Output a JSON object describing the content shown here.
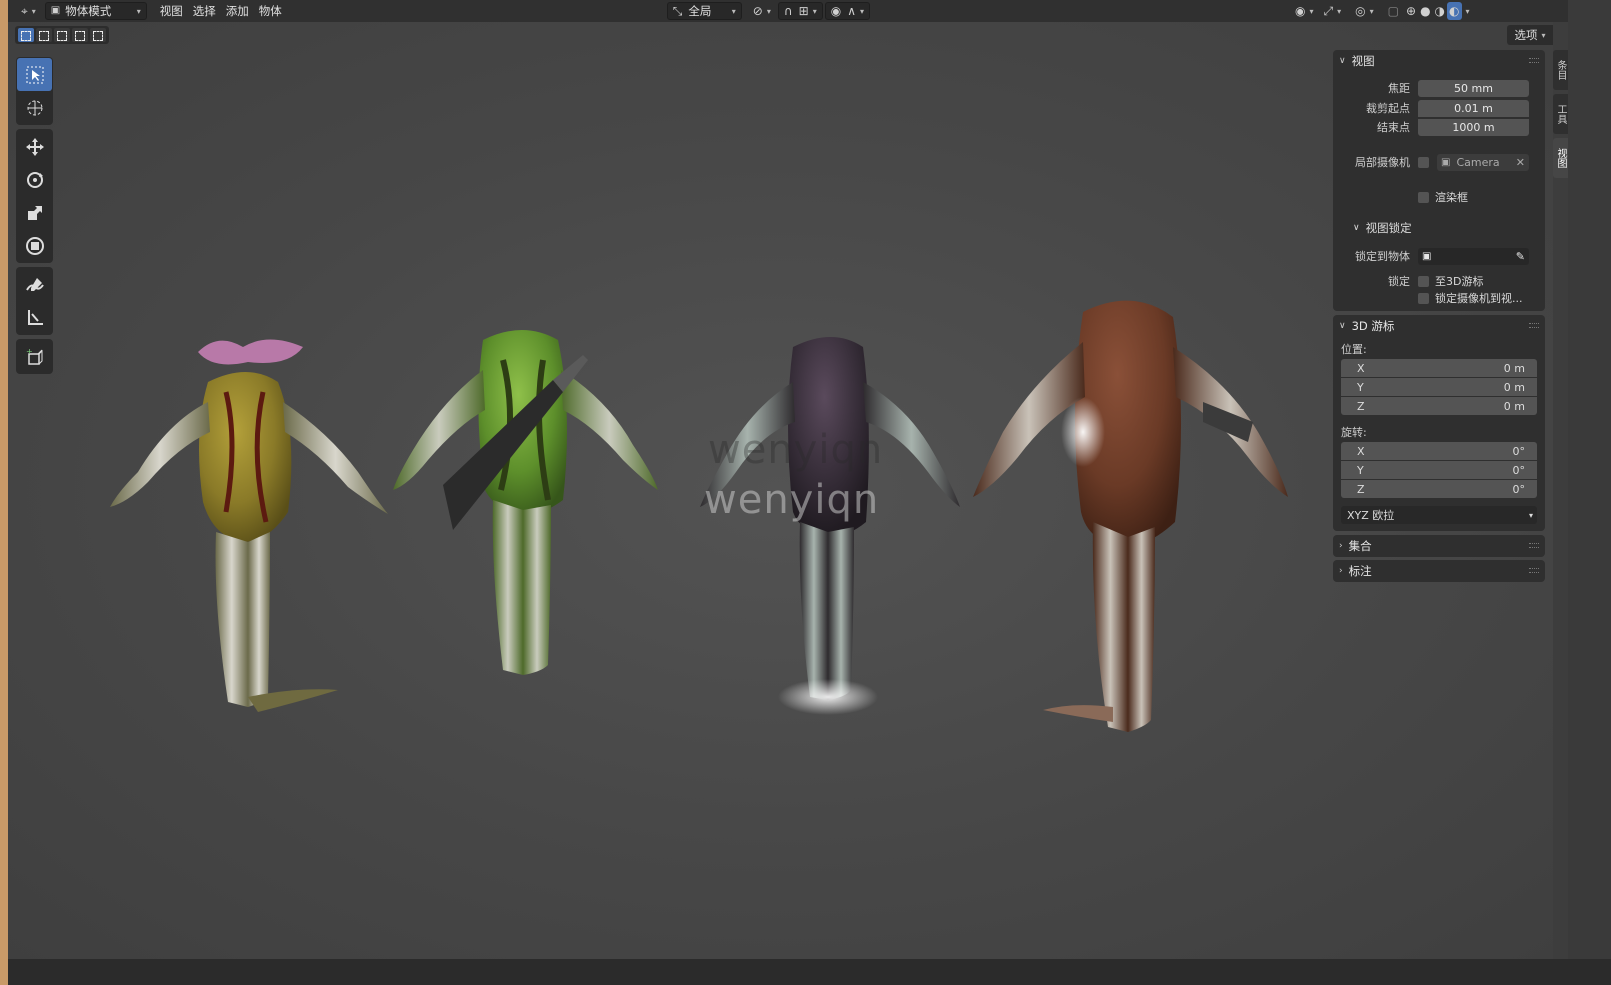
{
  "header": {
    "editor_type_icon": "viewport-editor-icon",
    "mode_label": "物体模式",
    "menus": [
      "视图",
      "选择",
      "添加",
      "物体"
    ],
    "transform_orientation": "全局",
    "icons_right": [
      "visibility-icon",
      "gizmo-icon",
      "overlay-icon",
      "xray-icon",
      "wireframe-shading-icon",
      "solid-shading-icon",
      "material-shading-icon",
      "rendered-shading-icon"
    ]
  },
  "viewport": {
    "options_label": "选项",
    "watermark_text": "wenyiqn",
    "watermark_ghost_text": "wenyiqn"
  },
  "toolbar": {
    "tools": [
      "select-box-icon",
      "cursor-icon",
      "move-icon",
      "rotate-icon",
      "scale-icon",
      "transform-icon",
      "annotate-icon",
      "measure-icon",
      "add-cube-icon"
    ]
  },
  "npanel": {
    "view": {
      "title": "视图",
      "focal_label": "焦距",
      "focal_value": "50 mm",
      "clip_start_label": "裁剪起点",
      "clip_start_value": "0.01 m",
      "clip_end_label": "结束点",
      "clip_end_value": "1000 m",
      "local_camera_label": "局部摄像机",
      "camera_name": "Camera",
      "render_region_label": "渲染框",
      "view_lock_title": "视图锁定",
      "lock_object_label": "锁定到物体",
      "lock_label": "锁定",
      "lock_cursor_label": "至3D游标",
      "lock_camera_label": "锁定摄像机到视..."
    },
    "cursor": {
      "title": "3D 游标",
      "location_label": "位置:",
      "location": [
        {
          "axis": "X",
          "value": "0 m"
        },
        {
          "axis": "Y",
          "value": "0 m"
        },
        {
          "axis": "Z",
          "value": "0 m"
        }
      ],
      "rotation_label": "旋转:",
      "rotation": [
        {
          "axis": "X",
          "value": "0°"
        },
        {
          "axis": "Y",
          "value": "0°"
        },
        {
          "axis": "Z",
          "value": "0°"
        }
      ],
      "rotation_mode": "XYZ 欧拉"
    },
    "collection": {
      "title": "集合"
    },
    "annotation": {
      "title": "标注"
    }
  },
  "sidetabs": [
    "条目",
    "工具",
    "视图"
  ]
}
